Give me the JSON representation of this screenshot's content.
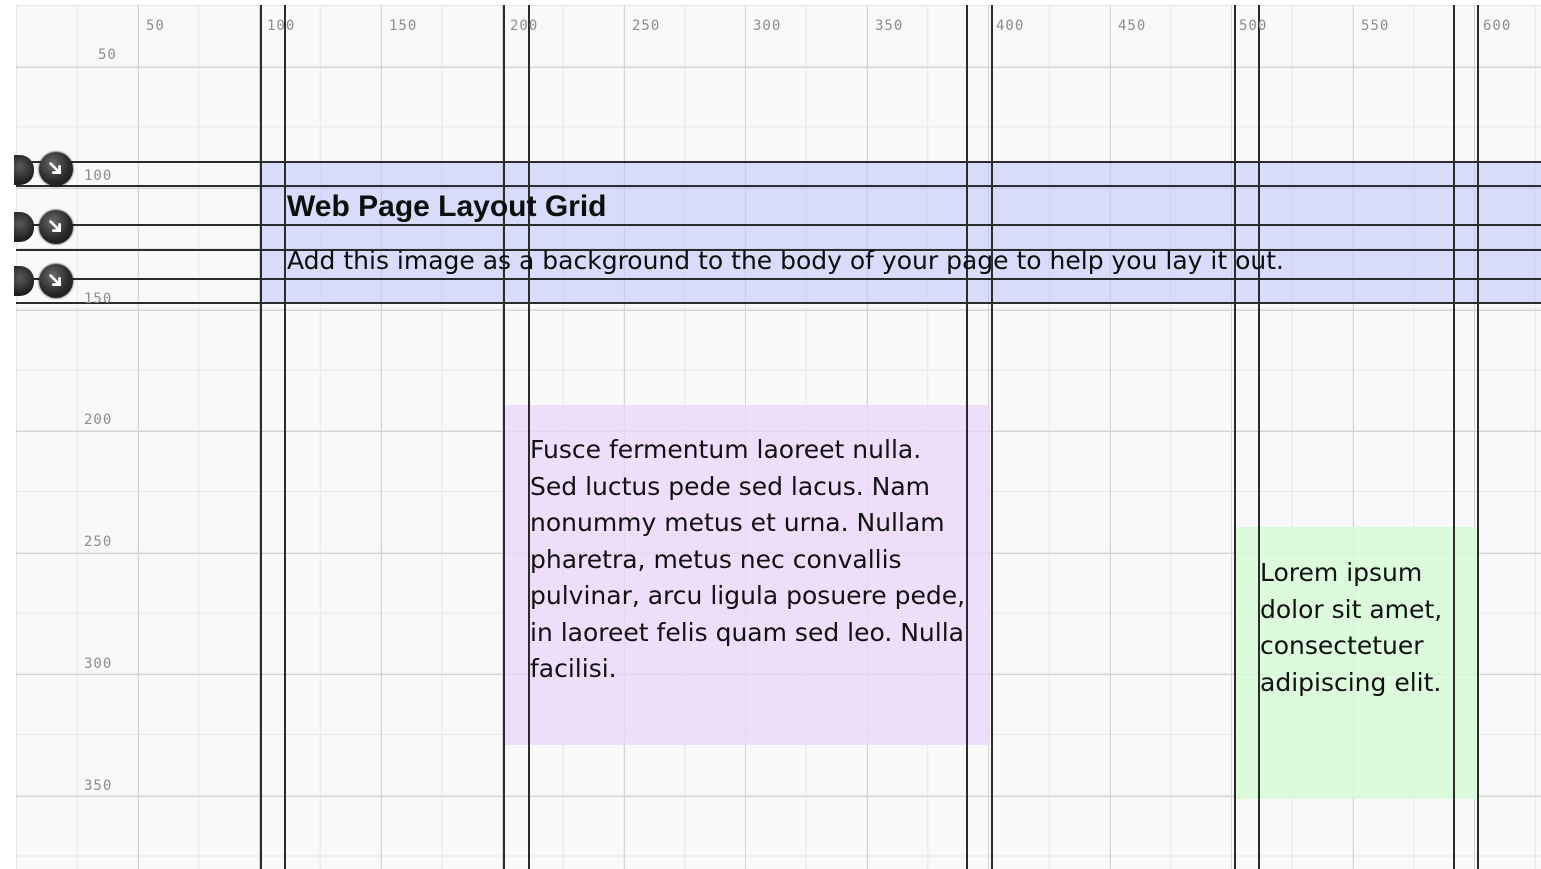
{
  "grid": {
    "x_ticks": [
      "50",
      "100",
      "150",
      "200",
      "250",
      "300",
      "350",
      "400",
      "450",
      "500",
      "550",
      "600"
    ],
    "y_ticks": [
      "50",
      "100",
      "150",
      "200",
      "250",
      "300",
      "350"
    ]
  },
  "header_block": {
    "title": "Web Page Layout Grid",
    "subtitle": "Add this image as a background to the body of your page to help you lay it out.",
    "color": "#c4c8fa"
  },
  "purple_block": {
    "text": "Fusce fermentum laoreet nulla. Sed luctus pede sed lacus. Nam nonummy metus et urna. Nullam pharetra, metus nec convallis pulvinar, arcu ligula posuere pede, in laoreet felis quam sed leo. Nulla facilisi.",
    "color": "#ecd9fa"
  },
  "green_block": {
    "text": "Lorem ipsum dolor sit amet, consectetuer adipiscing elit.",
    "color": "#d8fad8"
  },
  "handles": {
    "icon": "resize-arrow-icon",
    "count": 3
  }
}
